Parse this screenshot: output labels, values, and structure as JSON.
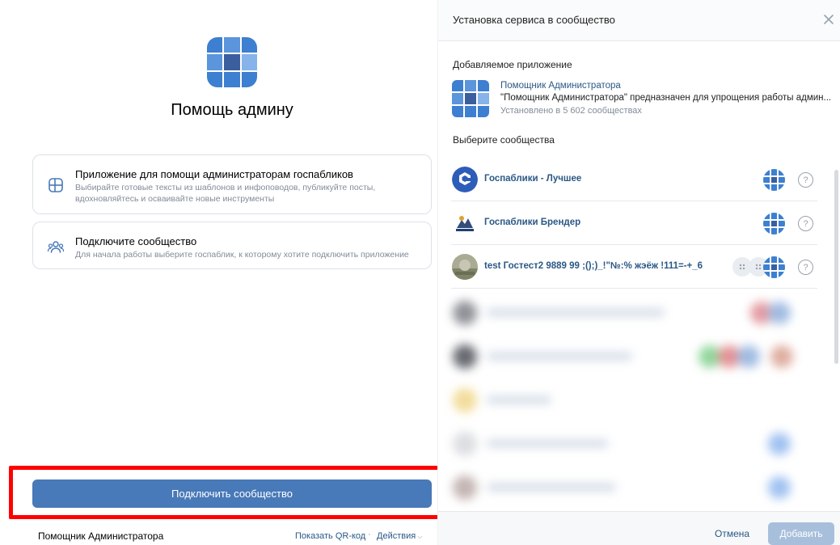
{
  "app": {
    "title": "Помощь админу"
  },
  "cards": [
    {
      "icon": "widget-icon",
      "title": "Приложение для помощи администраторам госпабликов",
      "description": "Выбирайте готовые тексты из шаблонов и инфоповодов, публикуйте посты, вдохновляйтесь и осваивайте новые инструменты"
    },
    {
      "icon": "users-icon",
      "title": "Подключите сообщество",
      "description": "Для начала работы выберите госпаблик, к которому хотите подключить приложение"
    }
  ],
  "cta": {
    "label": "Подключить сообщество"
  },
  "footer": {
    "app_name": "Помощник Администратора",
    "qr_label": "Показать QR-код",
    "separator": "·",
    "actions_label": "Действия"
  },
  "modal": {
    "title": "Установка сервиса в сообщество",
    "close_icon": "close-icon",
    "app_section_label": "Добавляемое приложение",
    "app_item": {
      "name": "Помощник Администратора",
      "description": "\"Помощник Администратора\" предназначен для упрощения работы админ...",
      "meta": "Установлено в 5 602 сообществах"
    },
    "choose_label": "Выберите сообщества",
    "communities": [
      {
        "name": "Госпаблики - Лучшее",
        "avatar": "logo-badge-blue",
        "help": "?"
      },
      {
        "name": "Госпаблики Брендер",
        "avatar": "illustration",
        "help": "?"
      },
      {
        "name": "test Гостест2 9889 99 ;();)_!\"№:% жэёж !111=-+_6",
        "avatar": "photo",
        "help": "?"
      }
    ],
    "cancel_label": "Отмена",
    "add_label": "Добавить"
  },
  "colors": {
    "accent": "#4879b8",
    "link": "#2a5885",
    "highlight": "#ff0000",
    "muted": "#818c99"
  }
}
